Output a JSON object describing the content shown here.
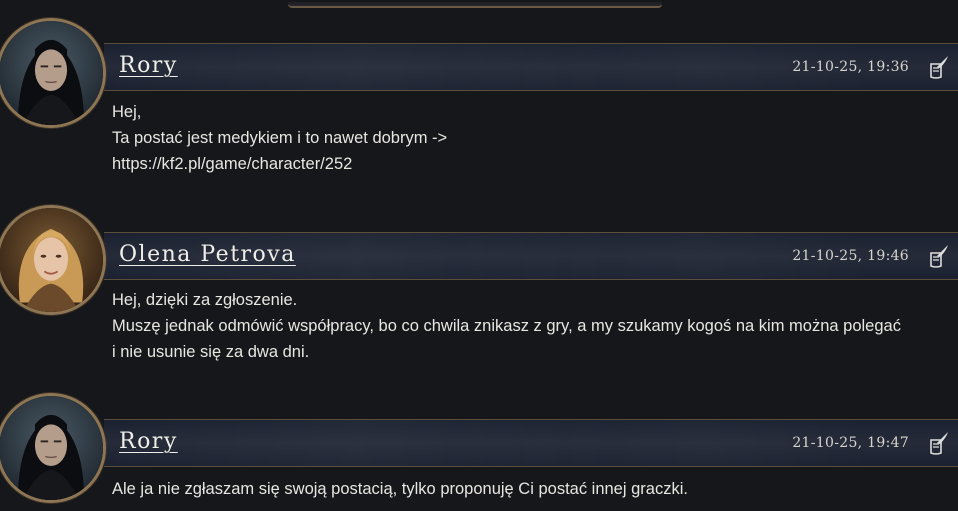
{
  "posts": [
    {
      "author": "Rory",
      "timestamp": "21-10-25, 19:36",
      "avatar": "rory-avatar",
      "lines": [
        "Hej,",
        "Ta postać jest medykiem i to nawet dobrym ->",
        "https://kf2.pl/game/character/252"
      ]
    },
    {
      "author": "Olena Petrova",
      "timestamp": "21-10-25, 19:46",
      "avatar": "olena-avatar",
      "lines": [
        "Hej, dzięki za zgłoszenie.",
        "Muszę jednak odmówić współpracy, bo co chwila znikasz z gry, a my szukamy kogoś na kim można polegać",
        "i nie usunie się za dwa dni."
      ]
    },
    {
      "author": "Rory",
      "timestamp": "21-10-25, 19:47",
      "avatar": "rory-avatar",
      "lines": [
        "Ale ja nie zgłaszam się swoją postacią, tylko proponuję Ci postać innej graczki."
      ]
    }
  ],
  "icons": {
    "quote": "quill-scroll-icon"
  },
  "colors": {
    "background": "#16171b",
    "header": "#252b39",
    "gold_border": "#8e7654"
  }
}
